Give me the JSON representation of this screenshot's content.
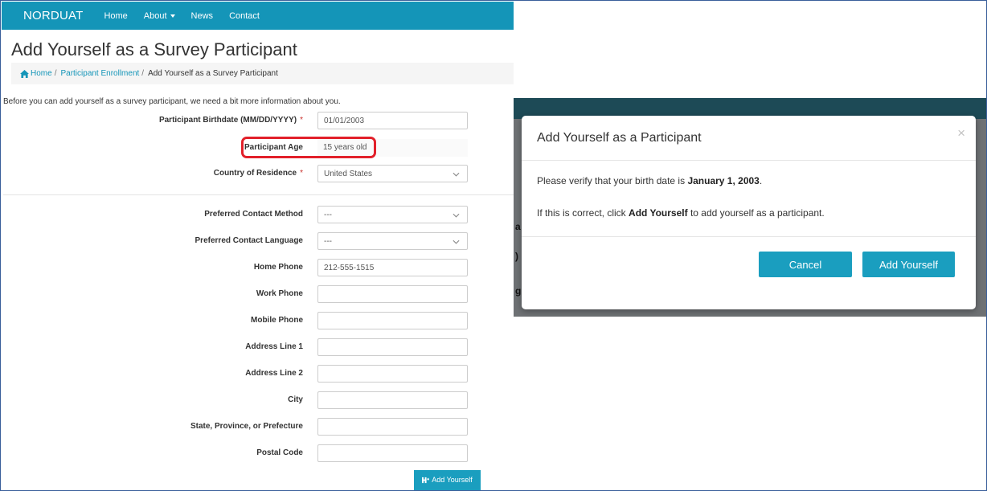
{
  "navbar": {
    "brand": "NORDUAT",
    "links": [
      "Home",
      "About",
      "News",
      "Contact"
    ]
  },
  "page": {
    "title": "Add Yourself as a Survey Participant",
    "breadcrumb": [
      "Home",
      "Participant Enrollment",
      "Add Yourself as a Survey Participant"
    ],
    "intro": "Before you can add yourself as a survey participant, we need a bit more information about you."
  },
  "form": {
    "birthdate": {
      "label": "Participant Birthdate (MM/DD/YYYY)",
      "value": "01/01/2003",
      "required": "*"
    },
    "age": {
      "label": "Participant Age",
      "value": "15 years old"
    },
    "country": {
      "label": "Country of Residence",
      "value": "United States",
      "required": "*"
    },
    "contact_method": {
      "label": "Preferred Contact Method",
      "value": "---"
    },
    "contact_language": {
      "label": "Preferred Contact Language",
      "value": "---"
    },
    "home_phone": {
      "label": "Home Phone",
      "value": "212-555-1515"
    },
    "work_phone": {
      "label": "Work Phone",
      "value": ""
    },
    "mobile_phone": {
      "label": "Mobile Phone",
      "value": ""
    },
    "address1": {
      "label": "Address Line 1",
      "value": ""
    },
    "address2": {
      "label": "Address Line 2",
      "value": ""
    },
    "city": {
      "label": "City",
      "value": ""
    },
    "state": {
      "label": "State, Province, or Prefecture",
      "value": ""
    },
    "postal": {
      "label": "Postal Code",
      "value": ""
    },
    "submit_label": "Add Yourself"
  },
  "modal": {
    "title": "Add Yourself as a Participant",
    "close": "×",
    "line1_prefix": "Please verify that your birth date is ",
    "line1_date": "January 1, 2003",
    "line1_suffix": ".",
    "line2_prefix": "If this is correct, click ",
    "line2_bold": "Add Yourself",
    "line2_suffix": " to add yourself as a participant.",
    "cancel_label": "Cancel",
    "confirm_label": "Add Yourself"
  },
  "colors": {
    "accent": "#1495b8",
    "button": "#1a9ebf",
    "highlight": "#e2202a",
    "modal_header_bg": "#1d4a56",
    "backdrop": "#6e7174"
  }
}
